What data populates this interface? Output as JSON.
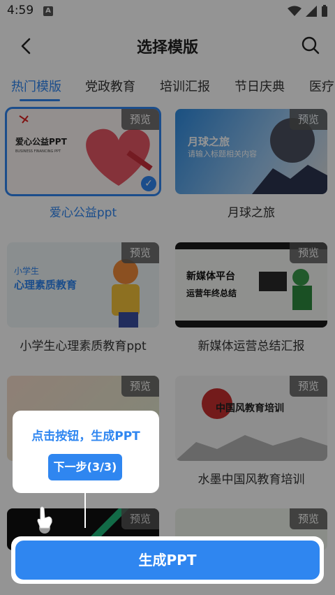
{
  "status": {
    "time": "4:59",
    "notif_letter": "A"
  },
  "header": {
    "title": "选择模版"
  },
  "tabs": [
    {
      "label": "热门模版",
      "active": true
    },
    {
      "label": "党政教育"
    },
    {
      "label": "培训汇报"
    },
    {
      "label": "节日庆典"
    },
    {
      "label": "医疗"
    }
  ],
  "preview_label": "预览",
  "templates": [
    {
      "name": "爱心公益ppt",
      "selected": true,
      "thumb_title": "爱心公益PPT",
      "thumb_sub": "BUSINESS FINANCING PPT"
    },
    {
      "name": "月球之旅",
      "thumb_title": "月球之旅",
      "thumb_sub": "请输入标题相关内容"
    },
    {
      "name": "小学生心理素质教育ppt",
      "thumb_title": "心理素质教育",
      "thumb_pre": "小学生"
    },
    {
      "name": "新媒体运营总结汇报",
      "thumb_title": "新媒体平台",
      "thumb_sub": "运营年终总结"
    },
    {
      "name": "",
      "thumb_title": ""
    },
    {
      "name": "水墨中国风教育培训",
      "thumb_title": "中国风教育培训"
    },
    {
      "name": ""
    },
    {
      "name": ""
    }
  ],
  "guide": {
    "text": "点击按钮，生成PPT",
    "next_label": "下一步(3/3)"
  },
  "generate_button": {
    "label": "生成PPT"
  },
  "colors": {
    "accent": "#2f86f0",
    "overlay": "rgba(0,0,0,0.42)"
  }
}
